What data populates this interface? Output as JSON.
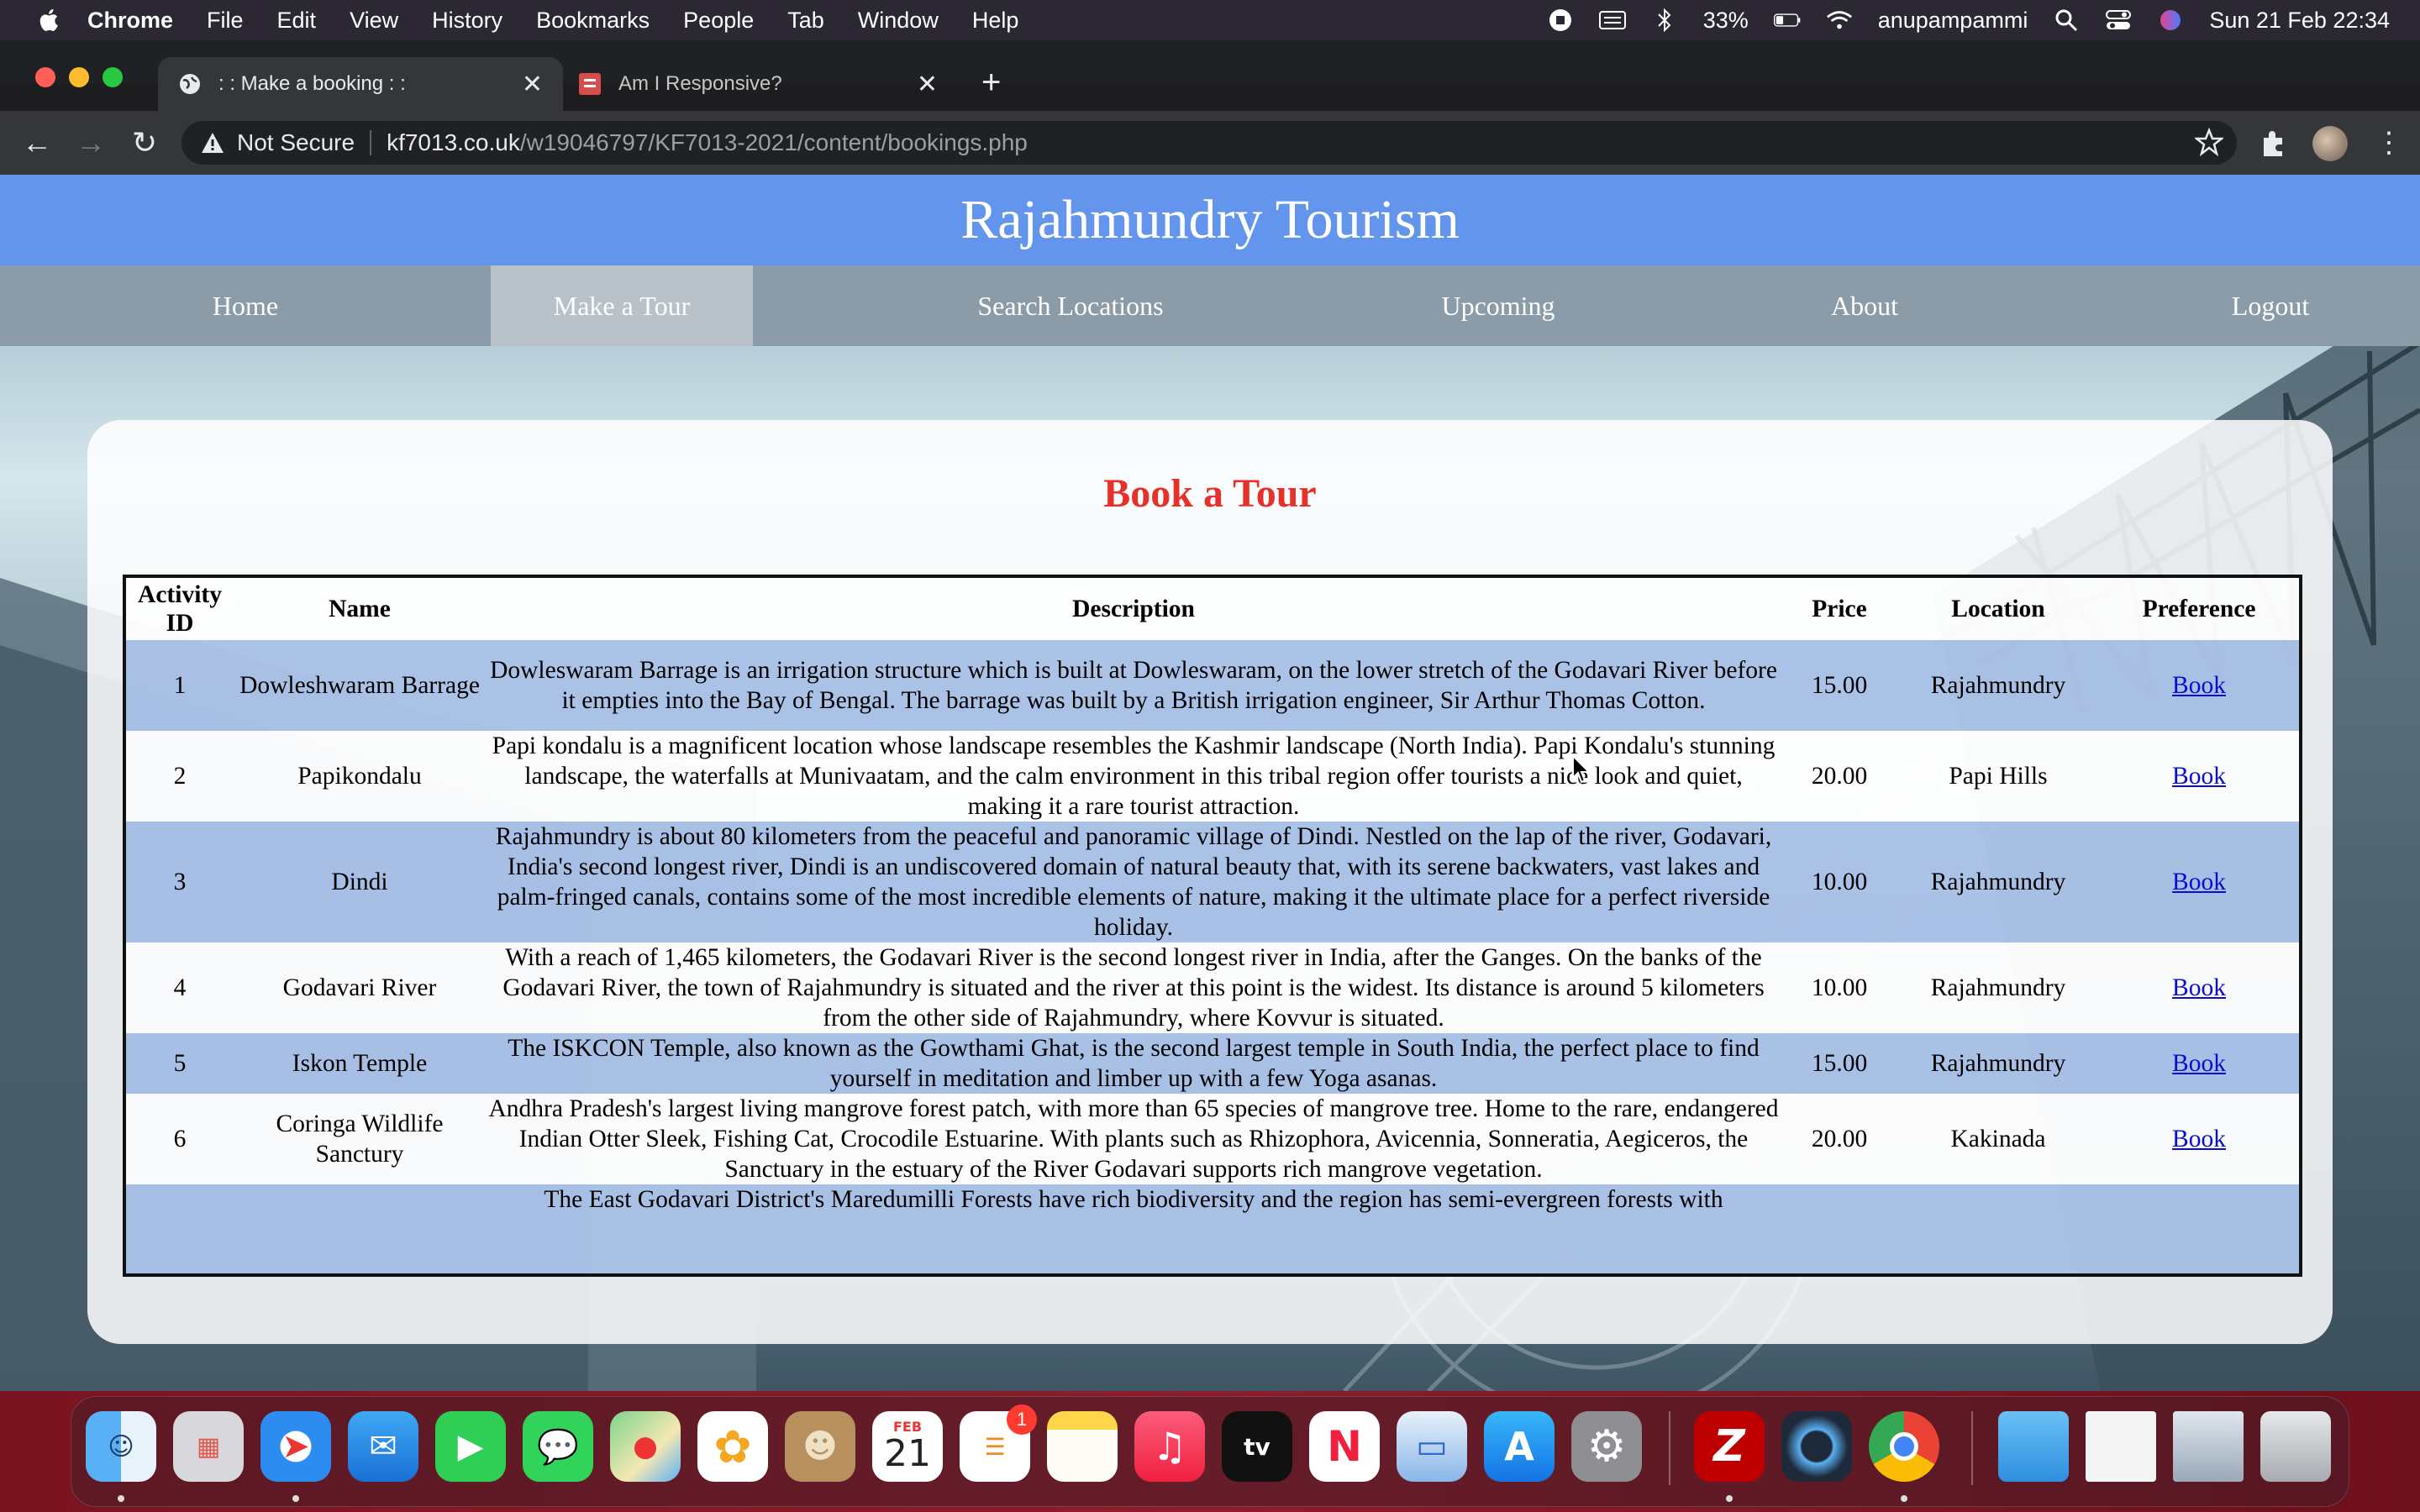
{
  "menubar": {
    "app_name": "Chrome",
    "items": [
      "File",
      "Edit",
      "View",
      "History",
      "Bookmarks",
      "People",
      "Tab",
      "Window",
      "Help"
    ],
    "battery": "33%",
    "user": "anupampammi",
    "datetime": "Sun 21 Feb  22:34"
  },
  "browser": {
    "tabs": [
      {
        "title": ": : Make a booking : :",
        "active": true
      },
      {
        "title": "Am I Responsive?",
        "active": false
      }
    ],
    "security_label": "Not Secure",
    "url_host": "kf7013.co.uk",
    "url_path": "/w19046797/KF7013-2021/content/bookings.php"
  },
  "site": {
    "title": "Rajahmundry Tourism",
    "nav": [
      "Home",
      "Make a Tour",
      "Search Locations",
      "Upcoming",
      "About",
      "Logout"
    ],
    "active_nav": "Make a Tour"
  },
  "booking": {
    "heading": "Book a Tour",
    "columns": [
      "Activity ID",
      "Name",
      "Description",
      "Price",
      "Location",
      "Preference"
    ],
    "rows": [
      {
        "id": "1",
        "name": "Dowleshwaram Barrage",
        "description": "Dowleswaram Barrage is an irrigation structure which is built at Dowleswaram, on the lower stretch of the Godavari River before it empties into the Bay of Bengal. The barrage was built by a British irrigation engineer, Sir Arthur Thomas Cotton.",
        "price": "15.00",
        "location": "Rajahmundry",
        "action": "Book"
      },
      {
        "id": "2",
        "name": "Papikondalu",
        "description": "Papi kondalu is a magnificent location whose landscape resembles the Kashmir landscape (North India). Papi Kondalu's stunning landscape, the waterfalls at Munivaatam, and the calm environment in this tribal region offer tourists a nice look and quiet, making it a rare tourist attraction.",
        "price": "20.00",
        "location": "Papi Hills",
        "action": "Book"
      },
      {
        "id": "3",
        "name": "Dindi",
        "description": "Rajahmundry is about 80 kilometers from the peaceful and panoramic village of Dindi. Nestled on the lap of the river, Godavari, India's second longest river, Dindi is an undiscovered domain of natural beauty that, with its serene backwaters, vast lakes and palm-fringed canals, contains some of the most incredible elements of nature, making it the ultimate place for a perfect riverside holiday.",
        "price": "10.00",
        "location": "Rajahmundry",
        "action": "Book"
      },
      {
        "id": "4",
        "name": "Godavari River",
        "description": "With a reach of 1,465 kilometers, the Godavari River is the second longest river in India, after the Ganges. On the banks of the Godavari River, the town of Rajahmundry is situated and the river at this point is the widest. Its distance is around 5 kilometers from the other side of Rajahmundry, where Kovvur is situated.",
        "price": "10.00",
        "location": "Rajahmundry",
        "action": "Book"
      },
      {
        "id": "5",
        "name": "Iskon Temple",
        "description": "The ISKCON Temple, also known as the Gowthami Ghat, is the second largest temple in South India, the perfect place to find yourself in meditation and limber up with a few Yoga asanas.",
        "price": "15.00",
        "location": "Rajahmundry",
        "action": "Book"
      },
      {
        "id": "6",
        "name": "Coringa Wildlife Sanctury",
        "description": "Andhra Pradesh's largest living mangrove forest patch, with more than 65 species of mangrove tree. Home to the rare, endangered Indian Otter Sleek, Fishing Cat, Crocodile Estuarine. With plants such as Rhizophora, Avicennia, Sonneratia, Aegiceros, the Sanctuary in the estuary of the River Godavari supports rich mangrove vegetation.",
        "price": "20.00",
        "location": "Kakinada",
        "action": "Book"
      },
      {
        "id": "",
        "name": "",
        "description": "The East Godavari District's Maredumilli Forests have rich biodiversity and the region has semi-evergreen forests with",
        "price": "",
        "location": "",
        "action": ""
      }
    ]
  },
  "dock": {
    "calendar_month": "FEB",
    "calendar_day": "21",
    "reminders_badge": "1",
    "apps": [
      "Finder",
      "Launchpad",
      "Safari",
      "Mail",
      "FaceTime",
      "Messages",
      "Maps",
      "Photos",
      "Contacts",
      "Calendar",
      "Reminders",
      "Notes",
      "Music",
      "TV",
      "News",
      "Keynote",
      "App Store",
      "System Preferences",
      "FileZilla",
      "QuickTime Player",
      "Google Chrome",
      "Downloads",
      "Recent Document",
      "Recent Screenshot",
      "Trash"
    ]
  }
}
